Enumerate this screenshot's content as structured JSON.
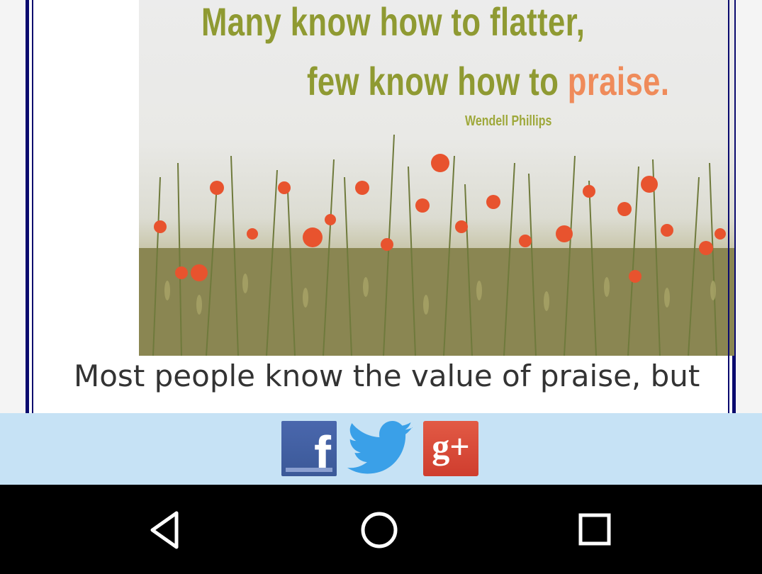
{
  "quote_image": {
    "line1": "Many know how to flatter,",
    "line2_prefix": "few know how to ",
    "line2_highlight": "praise.",
    "author": "Wendell Phillips"
  },
  "article": {
    "first_line": "Most people know the value of praise, but"
  },
  "share_bar": {
    "facebook_glyph": "f",
    "google_plus_glyph": "g+"
  },
  "colors": {
    "frame_border": "#0a0a6e",
    "share_bar_bg": "#c6e2f5",
    "facebook": "#3b5998",
    "twitter": "#1da1f2",
    "google_plus": "#dd4b39",
    "quote_text": "#8f9a32",
    "quote_highlight": "#ef8b5a"
  },
  "icons": {
    "facebook": "facebook-icon",
    "twitter": "twitter-icon",
    "google_plus": "google-plus-icon",
    "back": "back-triangle-icon",
    "home": "home-circle-icon",
    "recents": "recents-square-icon"
  }
}
